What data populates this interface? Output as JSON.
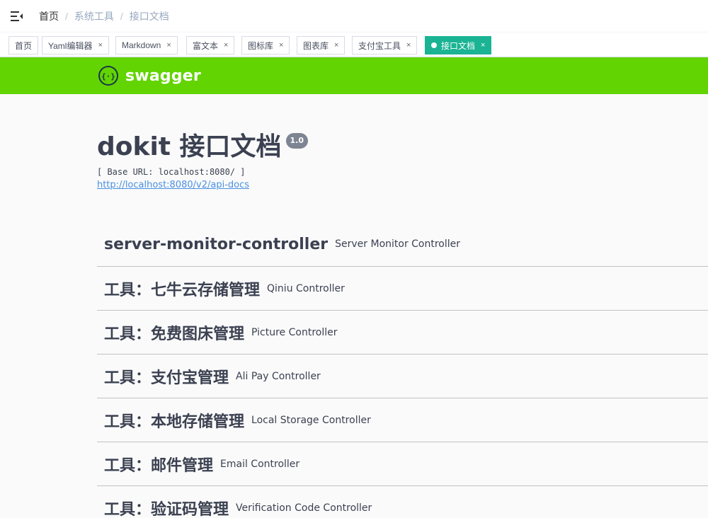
{
  "navbar": {
    "breadcrumb": [
      "首页",
      "系统工具",
      "接口文档"
    ]
  },
  "tags": [
    {
      "label": "首页",
      "closable": false,
      "active": false
    },
    {
      "label": "Yaml编辑器",
      "closable": true,
      "active": false
    },
    {
      "label": "Markdown",
      "closable": true,
      "active": false
    },
    {
      "label": "富文本",
      "closable": true,
      "active": false
    },
    {
      "label": "图标库",
      "closable": true,
      "active": false
    },
    {
      "label": "图表库",
      "closable": true,
      "active": false
    },
    {
      "label": "支付宝工具",
      "closable": true,
      "active": false
    },
    {
      "label": "接口文档",
      "closable": true,
      "active": true
    }
  ],
  "tag_close_glyph": "×",
  "swagger": {
    "logo_text": "swagger",
    "logo_icon": "swagger-braces-icon",
    "brand_color": "#62d402",
    "title": "dokit 接口文档",
    "version": "1.0",
    "base_url": "[ Base URL: localhost:8080/ ]",
    "spec_link": "http://localhost:8080/v2/api-docs",
    "sections": [
      {
        "name": "server-monitor-controller",
        "desc": "Server Monitor Controller"
      },
      {
        "name": "工具：七牛云存储管理",
        "desc": "Qiniu Controller"
      },
      {
        "name": "工具：免费图床管理",
        "desc": "Picture Controller"
      },
      {
        "name": "工具：支付宝管理",
        "desc": "Ali Pay Controller"
      },
      {
        "name": "工具：本地存储管理",
        "desc": "Local Storage Controller"
      },
      {
        "name": "工具：邮件管理",
        "desc": "Email Controller"
      },
      {
        "name": "工具：验证码管理",
        "desc": "Verification Code Controller"
      }
    ]
  },
  "colors": {
    "active_tag": "#1ab394",
    "link": "#4990e2",
    "text": "#3b4151"
  }
}
